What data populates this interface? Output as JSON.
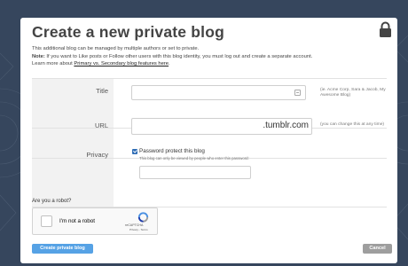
{
  "dialog": {
    "title": "Create a new private blog",
    "intro_line1": "This additional blog can be managed by multiple authors or set to private.",
    "note_label": "Note:",
    "note_text": " If you want to Like posts or Follow other users with this blog identity, you must log out and create a separate account.",
    "learn_prefix": "Learn more about ",
    "learn_link": "Primary vs. Secondary blog features here",
    "learn_suffix": "."
  },
  "form": {
    "title_label": "Title",
    "title_value": "",
    "title_hint": "(ie. Acme Corp, Sara & Jacob, My Awesome Blog)",
    "url_label": "URL",
    "url_value": "",
    "url_suffix": ".tumblr.com",
    "url_hint": "(you can change this at any time)",
    "privacy_label": "Privacy",
    "password_checkbox_label": "Password protect this blog",
    "password_checked": true,
    "password_help": "This blog can only be viewed by people who enter this password:",
    "password_value": ""
  },
  "captcha": {
    "question": "Are you a robot?",
    "checkbox_label": "I'm not a robot",
    "brand": "reCAPTCHA",
    "links": "Privacy - Terms"
  },
  "buttons": {
    "create": "Create private blog",
    "cancel": "Cancel"
  },
  "colors": {
    "backdrop": "#36465d",
    "primary_button": "#56a2e5",
    "cancel_button": "#9e9e9e",
    "checkbox_accent": "#2f6db5"
  },
  "icons": {
    "lock": "lock-icon",
    "title_field": "contact-card-icon",
    "recaptcha": "recaptcha-logo-icon"
  }
}
